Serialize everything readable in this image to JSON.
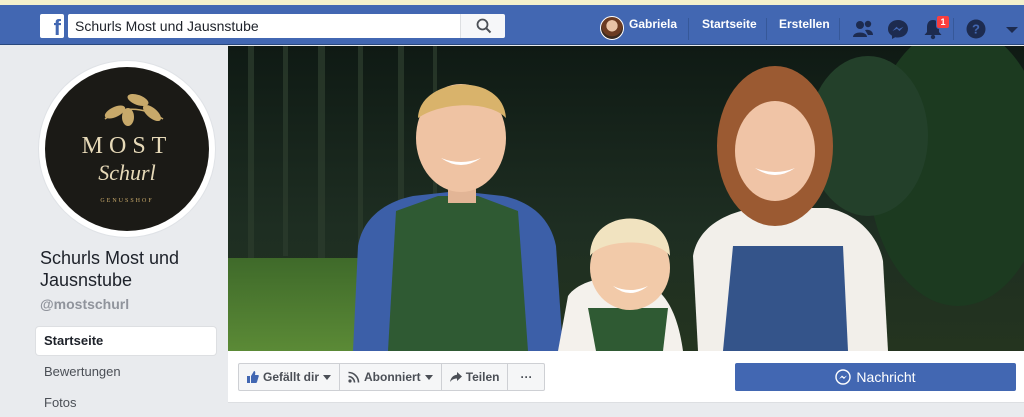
{
  "topbar": {
    "search_value": "Schurls Most und Jausnstube",
    "user_name": "Gabriela",
    "nav_home": "Startseite",
    "nav_create": "Erstellen",
    "notification_count": "1"
  },
  "page": {
    "name": "Schurls Most und Jausnstube",
    "handle": "@mostschurl",
    "logo": {
      "line1": "MOST",
      "line2": "Schurl",
      "line3": "GENUSSHOF"
    }
  },
  "sidebar": {
    "items": [
      {
        "label": "Startseite",
        "active": true
      },
      {
        "label": "Bewertungen",
        "active": false
      },
      {
        "label": "Fotos",
        "active": false
      }
    ]
  },
  "actions": {
    "like": "Gefällt dir",
    "follow": "Abonniert",
    "share": "Teilen",
    "more": "···",
    "message": "Nachricht"
  },
  "colors": {
    "brand": "#4267b2",
    "background": "#e9ebee",
    "badge": "#fa3e3e"
  }
}
